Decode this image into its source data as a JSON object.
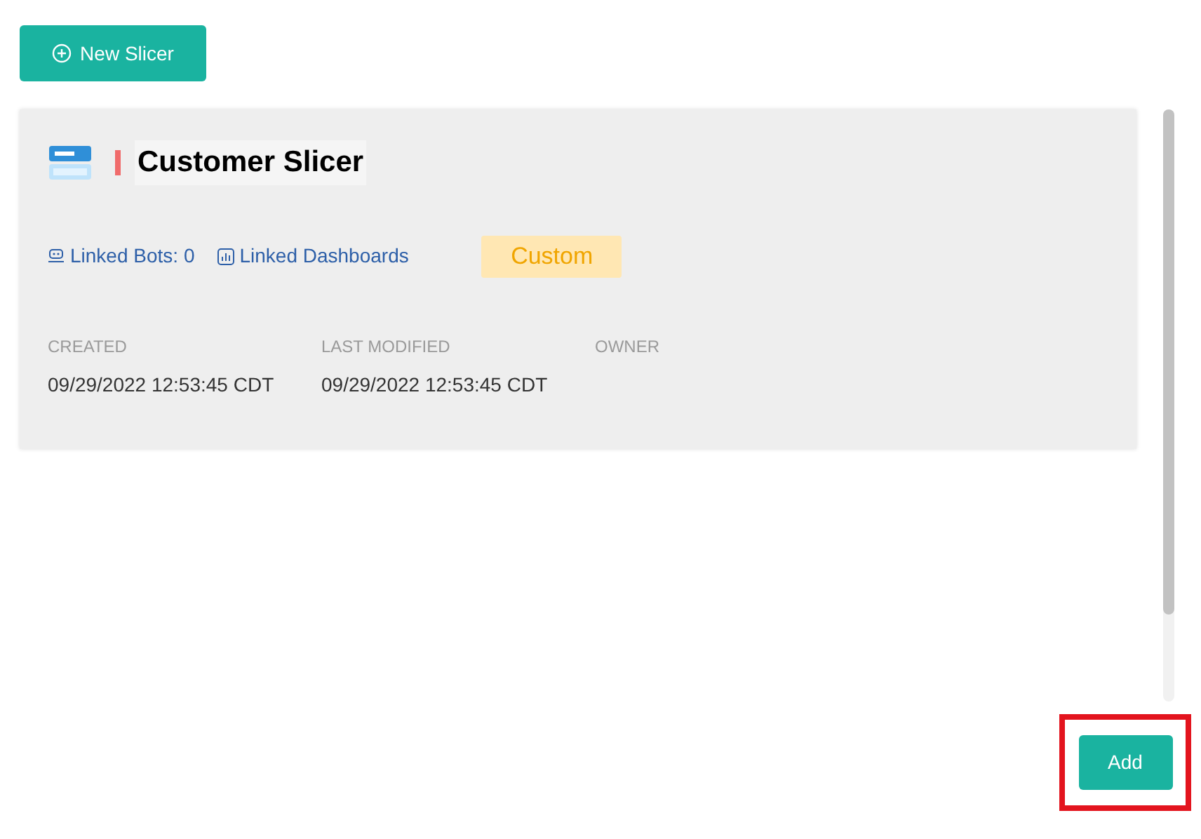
{
  "new_button": {
    "label": "New Slicer"
  },
  "slicer": {
    "title": "Customer Slicer",
    "links": [
      {
        "kind": "bots",
        "label": "Linked Bots: 0"
      },
      {
        "kind": "dashboards",
        "label": "Linked Dashboards"
      }
    ],
    "tag": "Custom",
    "meta": [
      {
        "label": "CREATED",
        "value": "09/29/2022 12:53:45 CDT"
      },
      {
        "label": "LAST MODIFIED",
        "value": "09/29/2022 12:53:45 CDT"
      },
      {
        "label": "OWNER"
      }
    ]
  },
  "add_button": {
    "label": "Add",
    "highlighted": true
  }
}
